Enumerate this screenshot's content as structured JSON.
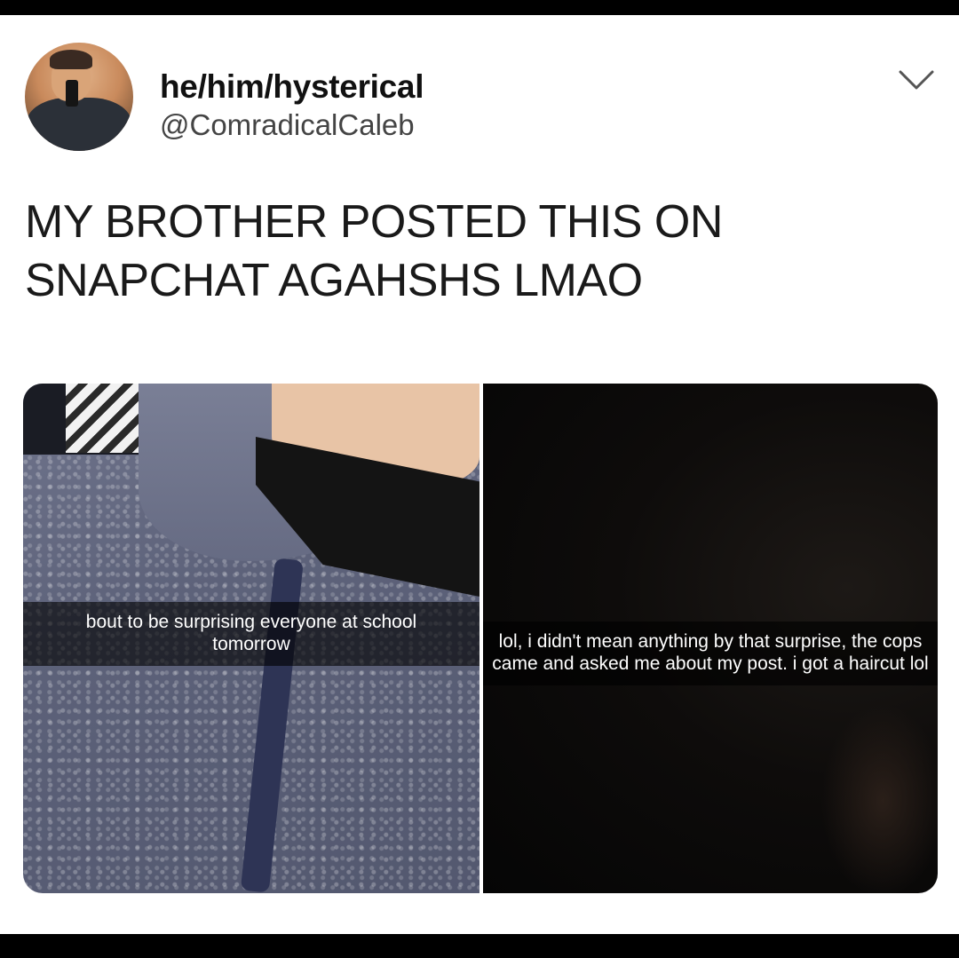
{
  "tweet": {
    "display_name": "he/him/hysterical",
    "handle": "@ComradicalCaleb",
    "text": "MY BROTHER POSTED THIS ON SNAPCHAT AGAHSHS LMAO"
  },
  "media": {
    "left_caption": "bout to be surprising everyone at school tomorrow",
    "right_caption": "lol, i didn't mean anything by that surprise, the cops came and asked me about my post. i got a haircut lol"
  },
  "icons": {
    "menu": "chevron-down-icon",
    "avatar": "profile-photo"
  },
  "colors": {
    "background": "#ffffff",
    "frame": "#000000",
    "text": "#1a1a1a",
    "handle": "#444444"
  }
}
